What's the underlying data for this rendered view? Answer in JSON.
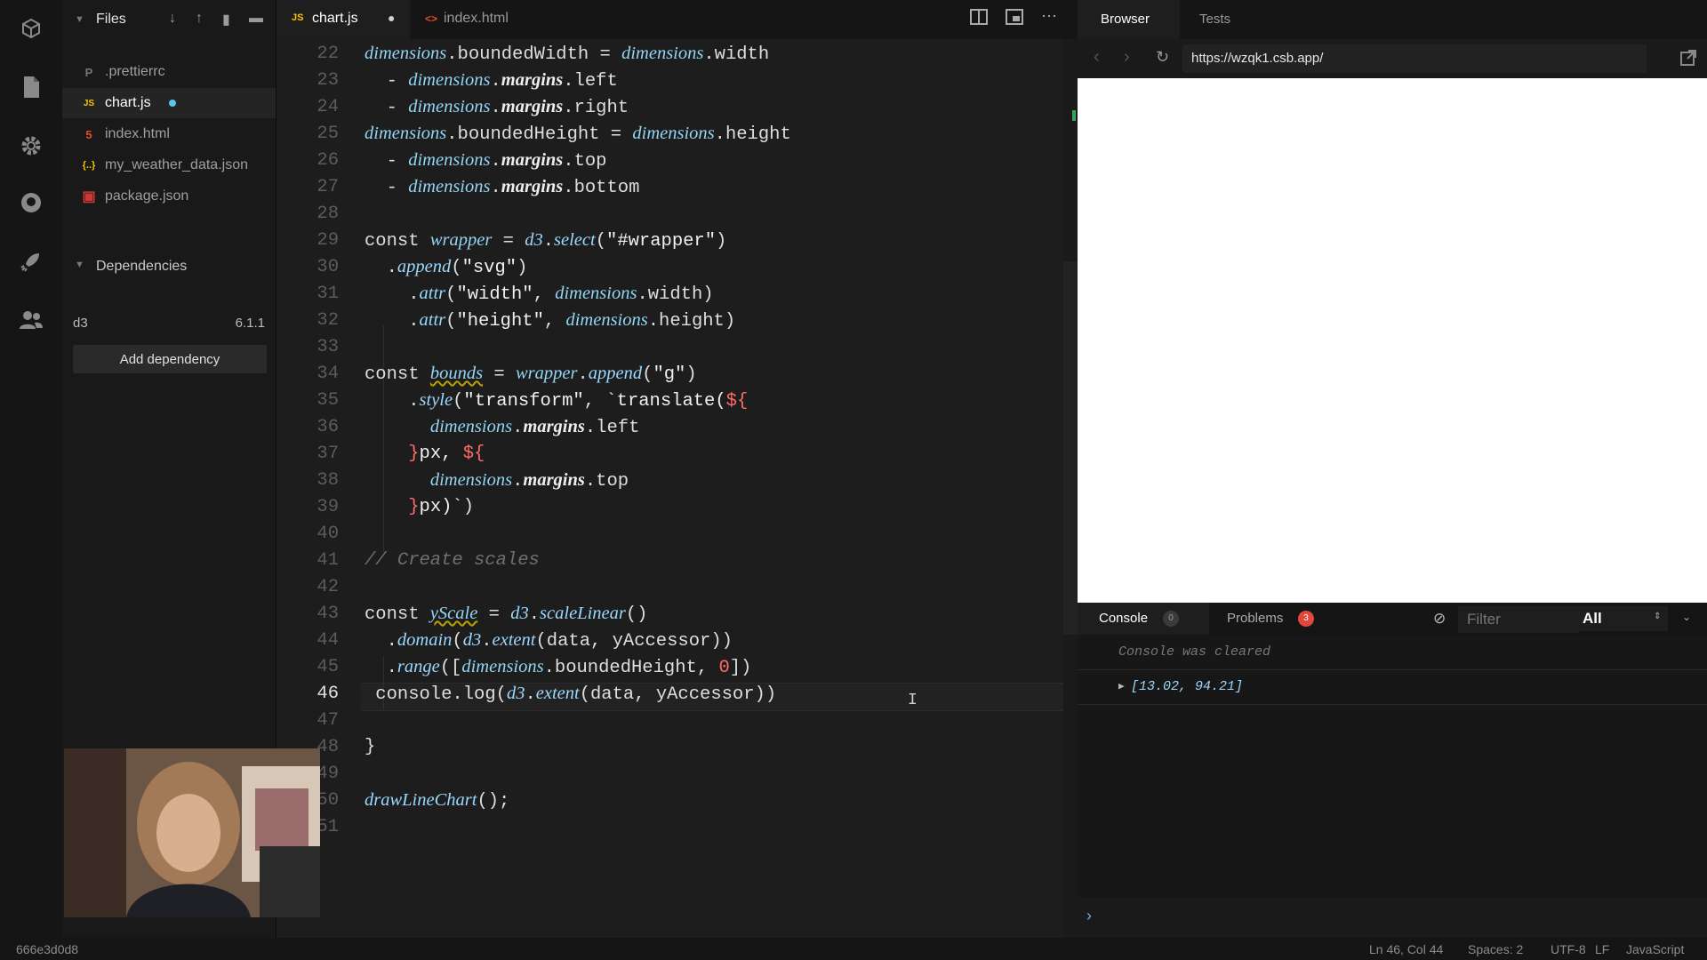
{
  "sidebar": {
    "title": "Files",
    "files": [
      {
        "icon": "P",
        "name": ".prettierrc",
        "color": "#777777"
      },
      {
        "icon": "JS",
        "name": "chart.js",
        "color": "#f5c400",
        "active": true,
        "modified": true
      },
      {
        "icon": "5",
        "name": "index.html",
        "color": "#e44d26"
      },
      {
        "icon": "{..}",
        "name": "my_weather_data.json",
        "color": "#f5c400"
      },
      {
        "icon": "▣",
        "name": "package.json",
        "color": "#cb3837"
      }
    ],
    "dependencies_label": "Dependencies",
    "dependency": {
      "name": "d3",
      "version": "6.1.1"
    },
    "add_dependency": "Add dependency"
  },
  "tabs": [
    {
      "icon": "JS",
      "label": "chart.js",
      "modified_dot": "●"
    },
    {
      "icon": "<>",
      "label": "index.html"
    }
  ],
  "code": {
    "current_line": 46,
    "lines": [
      {
        "n": 22,
        "html": "<span class='v'>dimensions</span>.boundedWidth = <span class='v'>dimensions</span>.width"
      },
      {
        "n": 23,
        "html": "  - <span class='v'>dimensions</span>.<span class='prop'>margins</span>.left"
      },
      {
        "n": 24,
        "html": "  - <span class='v'>dimensions</span>.<span class='prop'>margins</span>.right"
      },
      {
        "n": 25,
        "html": "<span class='v'>dimensions</span>.boundedHeight = <span class='v'>dimensions</span>.height"
      },
      {
        "n": 26,
        "html": "  - <span class='v'>dimensions</span>.<span class='prop'>margins</span>.top"
      },
      {
        "n": 27,
        "html": "  - <span class='v'>dimensions</span>.<span class='prop'>margins</span>.bottom"
      },
      {
        "n": 28,
        "html": ""
      },
      {
        "n": 29,
        "html": "<span class='kw'>const</span> <span class='v'>wrapper</span> = <span class='fn'>d3</span>.<span class='fn'>select</span>(<span class='str'>\"#wrapper\"</span>)"
      },
      {
        "n": 30,
        "html": "  .<span class='fn'>append</span>(<span class='str'>\"svg\"</span>)"
      },
      {
        "n": 31,
        "html": "    .<span class='fn'>attr</span>(<span class='str'>\"width\"</span>, <span class='v'>dimensions</span>.width)"
      },
      {
        "n": 32,
        "html": "    .<span class='fn'>attr</span>(<span class='str'>\"height\"</span>, <span class='v'>dimensions</span>.height)"
      },
      {
        "n": 33,
        "html": ""
      },
      {
        "n": 34,
        "html": "<span class='kw'>const</span> <span class='v' style='text-decoration:underline wavy #b8a000'>bounds</span> = <span class='v'>wrapper</span>.<span class='fn'>append</span>(<span class='str'>\"g\"</span>)"
      },
      {
        "n": 35,
        "html": "    .<span class='fn'>style</span>(<span class='str'>\"transform\"</span>, <span class='str'>`translate(</span><span class='tpl'>${</span>"
      },
      {
        "n": 36,
        "html": "      <span class='v'>dimensions</span>.<span class='prop'>margins</span>.left"
      },
      {
        "n": 37,
        "html": "    <span class='tpl'>}</span><span class='str'>px, </span><span class='tpl'>${</span>"
      },
      {
        "n": 38,
        "html": "      <span class='v'>dimensions</span>.<span class='prop'>margins</span>.top"
      },
      {
        "n": 39,
        "html": "    <span class='tpl'>}</span><span class='str'>px)`</span>)"
      },
      {
        "n": 40,
        "html": ""
      },
      {
        "n": 41,
        "html": "<span class='cmt'>// Create scales</span>"
      },
      {
        "n": 42,
        "html": ""
      },
      {
        "n": 43,
        "html": "<span class='kw'>const</span> <span class='v' style='text-decoration:underline wavy #b8a000'>yScale</span> = <span class='fn'>d3</span>.<span class='fn'>scaleLinear</span>()"
      },
      {
        "n": 44,
        "html": "  .<span class='fn'>domain</span>(<span class='fn'>d3</span>.<span class='fn'>extent</span>(data, yAccessor))"
      },
      {
        "n": 45,
        "html": "  .<span class='fn'>range</span>([<span class='v'>dimensions</span>.boundedHeight, <span class='num'>0</span>])"
      },
      {
        "n": 46,
        "html": " console.log(<span class='fn'>d3</span>.<span class='fn'>extent</span>(data, yAccessor))"
      },
      {
        "n": 47,
        "html": ""
      },
      {
        "n": 48,
        "html": "}"
      },
      {
        "n": 49,
        "html": ""
      },
      {
        "n": 50,
        "html": "<span class='fn'>drawLineChart</span>();"
      },
      {
        "n": 51,
        "html": ""
      }
    ]
  },
  "browser": {
    "tabs": [
      "Browser",
      "Tests"
    ],
    "url": "https://wzqk1.csb.app/"
  },
  "console": {
    "tab_label": "Console",
    "console_count": "0",
    "problems_label": "Problems",
    "problems_count": "3",
    "filter_placeholder": "Filter",
    "level": "All",
    "cleared_message": "Console was cleared",
    "output": "[13.02, 94.21]",
    "prompt": "›"
  },
  "status": {
    "commit": "666e3d0d8",
    "position": "Ln 46, Col 44",
    "spaces": "Spaces: 2",
    "encoding": "UTF-8",
    "eol": "LF",
    "language": "JavaScript"
  }
}
